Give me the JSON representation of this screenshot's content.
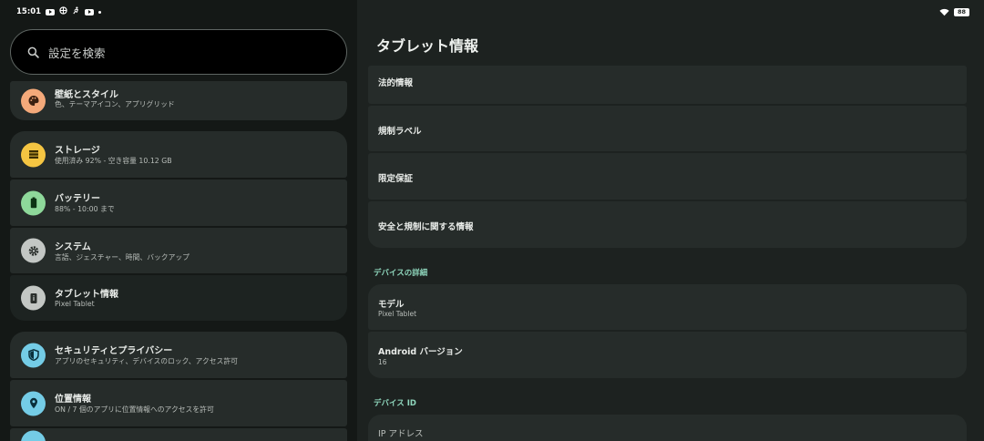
{
  "status_bar": {
    "time": "15:01",
    "battery": "88"
  },
  "search": {
    "placeholder": "設定を検索"
  },
  "settings_list": [
    {
      "title": "壁紙とスタイル",
      "subtitle": "色、テーマアイコン、アプリグリッド",
      "icon": "palette-icon",
      "color": "#f4a97a"
    },
    {
      "title": "ストレージ",
      "subtitle": "使用済み 92% - 空き容量 10.12 GB",
      "icon": "storage-icon",
      "color": "#f5c542"
    },
    {
      "title": "バッテリー",
      "subtitle": "88% - 10:00 まで",
      "icon": "battery-icon",
      "color": "#8ed89a"
    },
    {
      "title": "システム",
      "subtitle": "言語、ジェスチャー、時間、バックアップ",
      "icon": "gear-icon",
      "color": "#c3c7c4"
    },
    {
      "title": "タブレット情報",
      "subtitle": "Pixel Tablet",
      "icon": "tablet-icon",
      "color": "#c3c7c4"
    },
    {
      "title": "セキュリティとプライバシー",
      "subtitle": "アプリのセキュリティ、デバイスのロック、アクセス許可",
      "icon": "shield-icon",
      "color": "#74cce6"
    },
    {
      "title": "位置情報",
      "subtitle": "ON / 7 個のアプリに位置情報へのアクセスを許可",
      "icon": "location-icon",
      "color": "#74cce6"
    }
  ],
  "detail": {
    "title": "タブレット情報",
    "legal_items": [
      {
        "title": "法的情報"
      },
      {
        "title": "規制ラベル"
      },
      {
        "title": "限定保証"
      },
      {
        "title": "安全と規制に関する情報"
      }
    ],
    "device_details_header": "デバイスの詳細",
    "device_details": [
      {
        "title": "モデル",
        "value": "Pixel Tablet"
      },
      {
        "title": "Android バージョン",
        "value": "16"
      }
    ],
    "device_id_header": "デバイス ID",
    "device_id": [
      {
        "title": "IP アドレス"
      }
    ]
  }
}
